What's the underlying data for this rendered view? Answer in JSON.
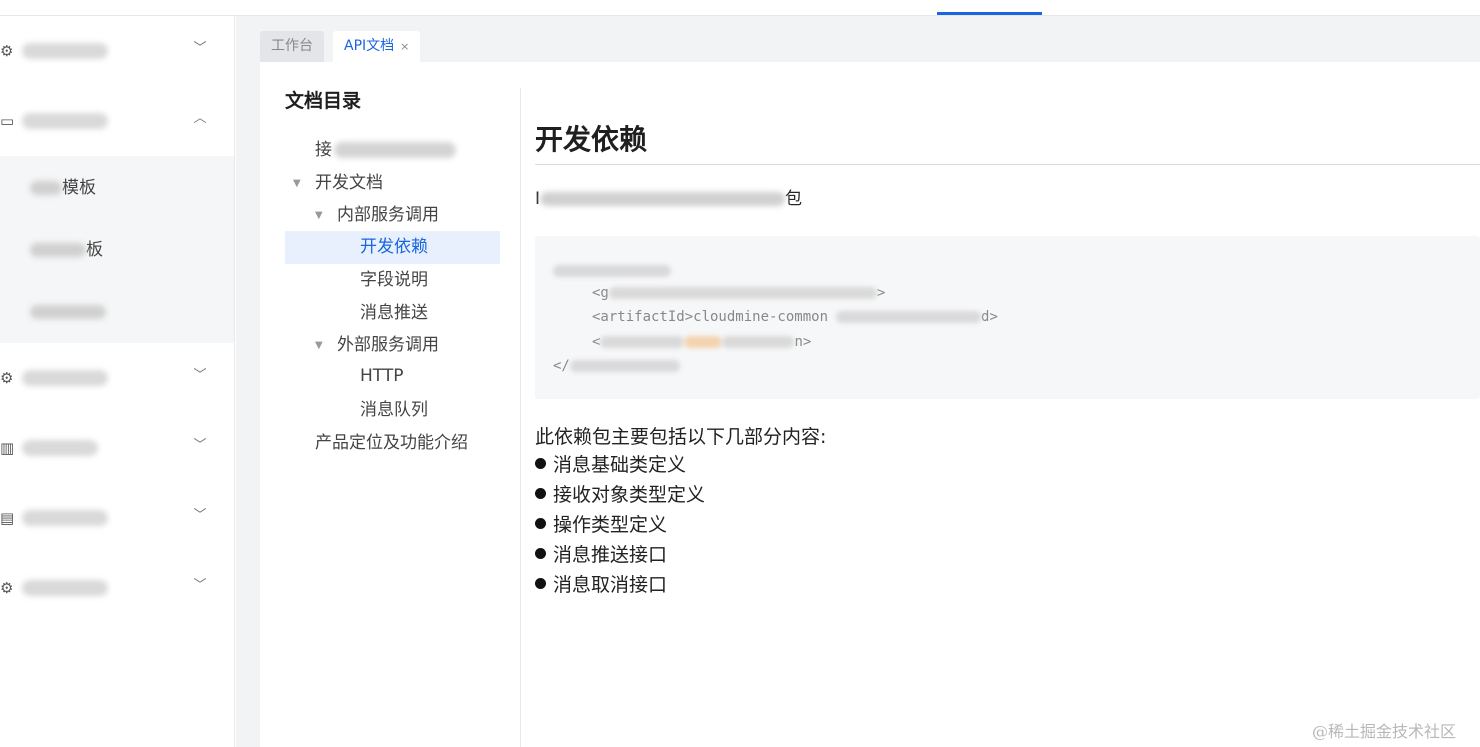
{
  "tabs": [
    {
      "label": "工作台",
      "active": false
    },
    {
      "label": "API文档",
      "active": true,
      "close": "×"
    }
  ],
  "sidebar": {
    "submenu_items": [
      {
        "label_end": "模板"
      },
      {
        "label_end": "板"
      }
    ]
  },
  "toc": {
    "title": "文档目录",
    "items": [
      {
        "label_start": "接"
      },
      {
        "label": "开发文档"
      },
      {
        "label": "内部服务调用"
      },
      {
        "label": "开发依赖"
      },
      {
        "label": "字段说明"
      },
      {
        "label": "消息推送"
      },
      {
        "label": "外部服务调用"
      },
      {
        "label": "HTTP"
      },
      {
        "label": "消息队列"
      },
      {
        "label": "产品定位及功能介绍"
      }
    ]
  },
  "doc": {
    "title": "开发依赖",
    "intro_start": "I",
    "intro_end": "包",
    "code": {
      "line1_prefix": "<g",
      "line1_suffix": ">",
      "line2_prefix": "<artifactId>cloudmine-common",
      "line2_suffix": "d>",
      "line3_prefix": "<",
      "line3_suffix": "n>",
      "line4_prefix": "</"
    },
    "lead": "此依赖包主要包括以下几部分内容:",
    "bullets": [
      "消息基础类定义",
      "接收对象类型定义",
      "操作类型定义",
      "消息推送接口",
      "消息取消接口"
    ]
  },
  "watermark": "@稀土掘金技术社区",
  "colors": {
    "accent": "#1a66e0",
    "selected_bg": "#e8f0fd"
  }
}
